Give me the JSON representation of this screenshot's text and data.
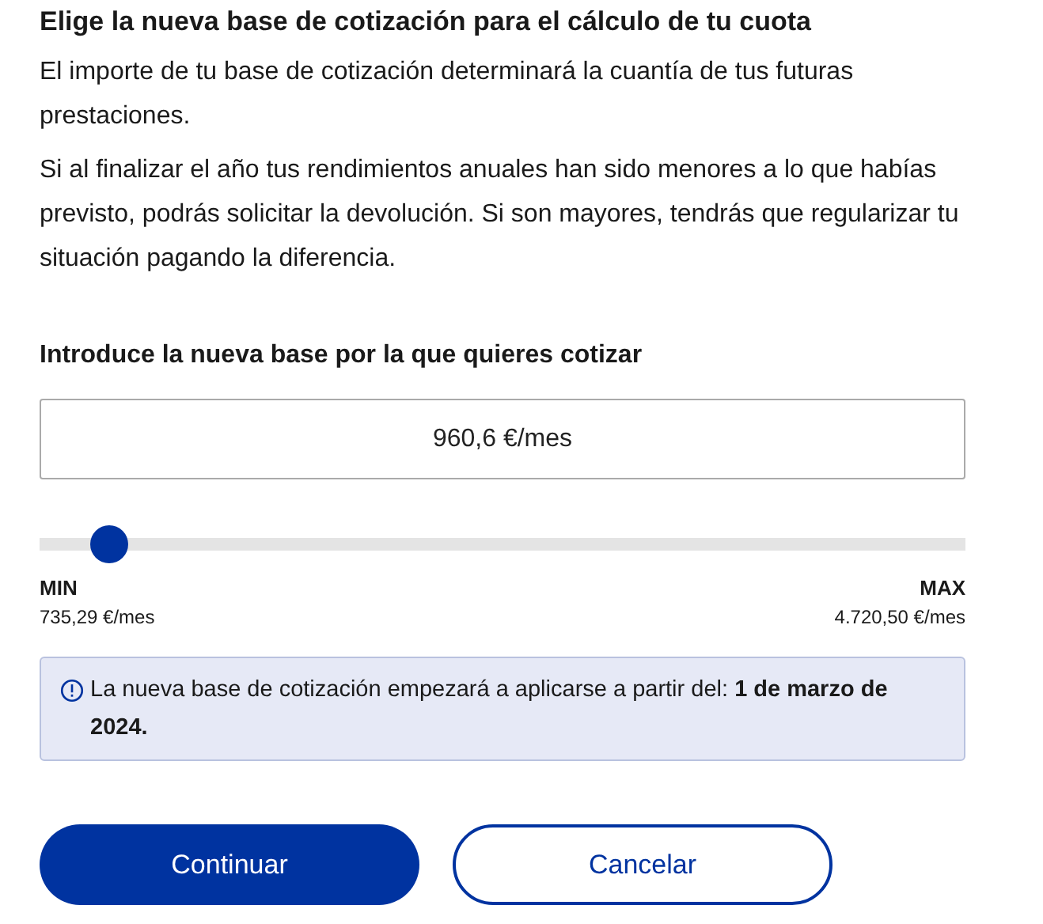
{
  "heading": "Elige la nueva base de cotización para el cálculo de tu cuota",
  "paragraphs": [
    "El importe de tu base de cotización determinará la cuantía de tus futuras prestaciones.",
    "Si al finalizar el año tus rendimientos anuales han sido menores a lo que habías previsto, podrás solicitar la devolución. Si son mayores, tendrás que regularizar tu situación pagando la diferencia."
  ],
  "input_label": "Introduce la nueva base por la que quieres cotizar",
  "amount_field": {
    "value": "960,6 €/mes"
  },
  "slider": {
    "level": 0.057,
    "min_label": "MIN",
    "min_value": "735,29 €/mes",
    "max_label": "MAX",
    "max_value": "4.720,50 €/mes"
  },
  "notice": "La nueva base de cotización empezará a aplicarse a partir del: **1 de marzo de 2024.**",
  "buttons": [
    {
      "label": "Continuar",
      "kind": "primary"
    },
    {
      "label": "Cancelar",
      "kind": "secondary"
    }
  ]
}
